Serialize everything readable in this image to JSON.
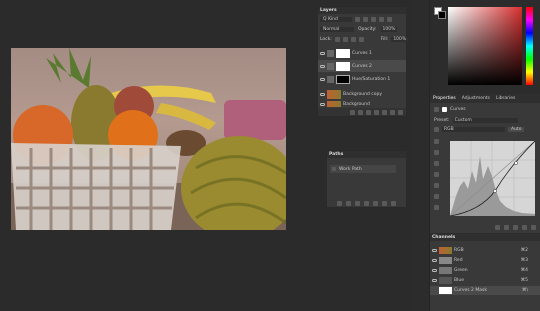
{
  "layers_panel": {
    "title": "Layers",
    "filter_label": "Q Kind",
    "blend_mode": "Normal",
    "opacity_label": "Opacity:",
    "opacity_value": "100%",
    "lock_label": "Lock:",
    "fill_label": "Fill:",
    "fill_value": "100%",
    "layers": [
      {
        "name": "Curves 1"
      },
      {
        "name": "Curves 2"
      },
      {
        "name": "Hue/Saturation 1"
      },
      {
        "name": "Background copy"
      },
      {
        "name": "Background"
      }
    ]
  },
  "paths_panel": {
    "title": "Paths",
    "items": [
      {
        "name": "Work Path"
      }
    ]
  },
  "properties_panel": {
    "tabs": [
      "Properties",
      "Adjustments",
      "Libraries"
    ],
    "adjustment_name": "Curves",
    "preset_label": "Preset:",
    "preset_value": "Custom",
    "channel_value": "RGB",
    "auto_label": "Auto"
  },
  "channels_panel": {
    "title": "Channels",
    "channels": [
      {
        "name": "RGB",
        "shortcut": "⌘2"
      },
      {
        "name": "Red",
        "shortcut": "⌘3"
      },
      {
        "name": "Green",
        "shortcut": "⌘4"
      },
      {
        "name": "Blue",
        "shortcut": "⌘5"
      },
      {
        "name": "Curves 2 Mask",
        "shortcut": "⌘\\"
      }
    ]
  },
  "colors": {
    "workspace_bg": "#2b2b2b",
    "panel_bg": "#393939",
    "accent_selected": "#4a4a4a"
  }
}
